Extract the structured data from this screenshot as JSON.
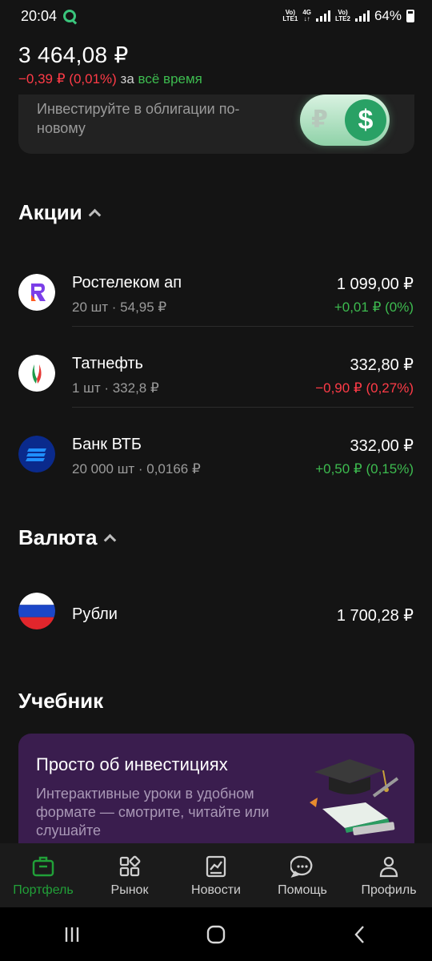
{
  "status_bar": {
    "time": "20:04",
    "battery": "64%",
    "sim1": "Vo) LTE1",
    "sim2": "Vo) LTE2",
    "net": "4G"
  },
  "header": {
    "total": "3 464,08 ₽",
    "change": "−0,39 ₽ (0,01%)",
    "change_word": "за",
    "period": "всё время"
  },
  "promo": {
    "text": "Инвестируйте в облигации по-новому",
    "toggle_left": "₽",
    "toggle_right": "$"
  },
  "stocks": {
    "title": "Акции",
    "items": [
      {
        "name": "Ростелеком ап",
        "sub": "20 шт · 54,95 ₽",
        "price": "1 099,00 ₽",
        "change": "+0,01 ₽ (0%)",
        "dir": "pos"
      },
      {
        "name": "Татнефть",
        "sub": "1 шт · 332,8 ₽",
        "price": "332,80 ₽",
        "change": "−0,90 ₽ (0,27%)",
        "dir": "neg"
      },
      {
        "name": "Банк ВТБ",
        "sub": "20 000 шт · 0,0166 ₽",
        "price": "332,00 ₽",
        "change": "+0,50 ₽ (0,15%)",
        "dir": "pos"
      }
    ]
  },
  "currency": {
    "title": "Валюта",
    "items": [
      {
        "name": "Рубли",
        "value": "1 700,28 ₽"
      }
    ]
  },
  "study": {
    "title": "Учебник",
    "card_title": "Просто об инвестициях",
    "card_desc": "Интерактивные уроки в удобном формате — смотрите, читайте или слушайте"
  },
  "nav": [
    {
      "label": "Портфель",
      "active": true
    },
    {
      "label": "Рынок"
    },
    {
      "label": "Новости"
    },
    {
      "label": "Помощь"
    },
    {
      "label": "Профиль"
    }
  ],
  "colors": {
    "accent": "#21a038",
    "positive": "#3dbb4f",
    "negative": "#ff3b47"
  }
}
